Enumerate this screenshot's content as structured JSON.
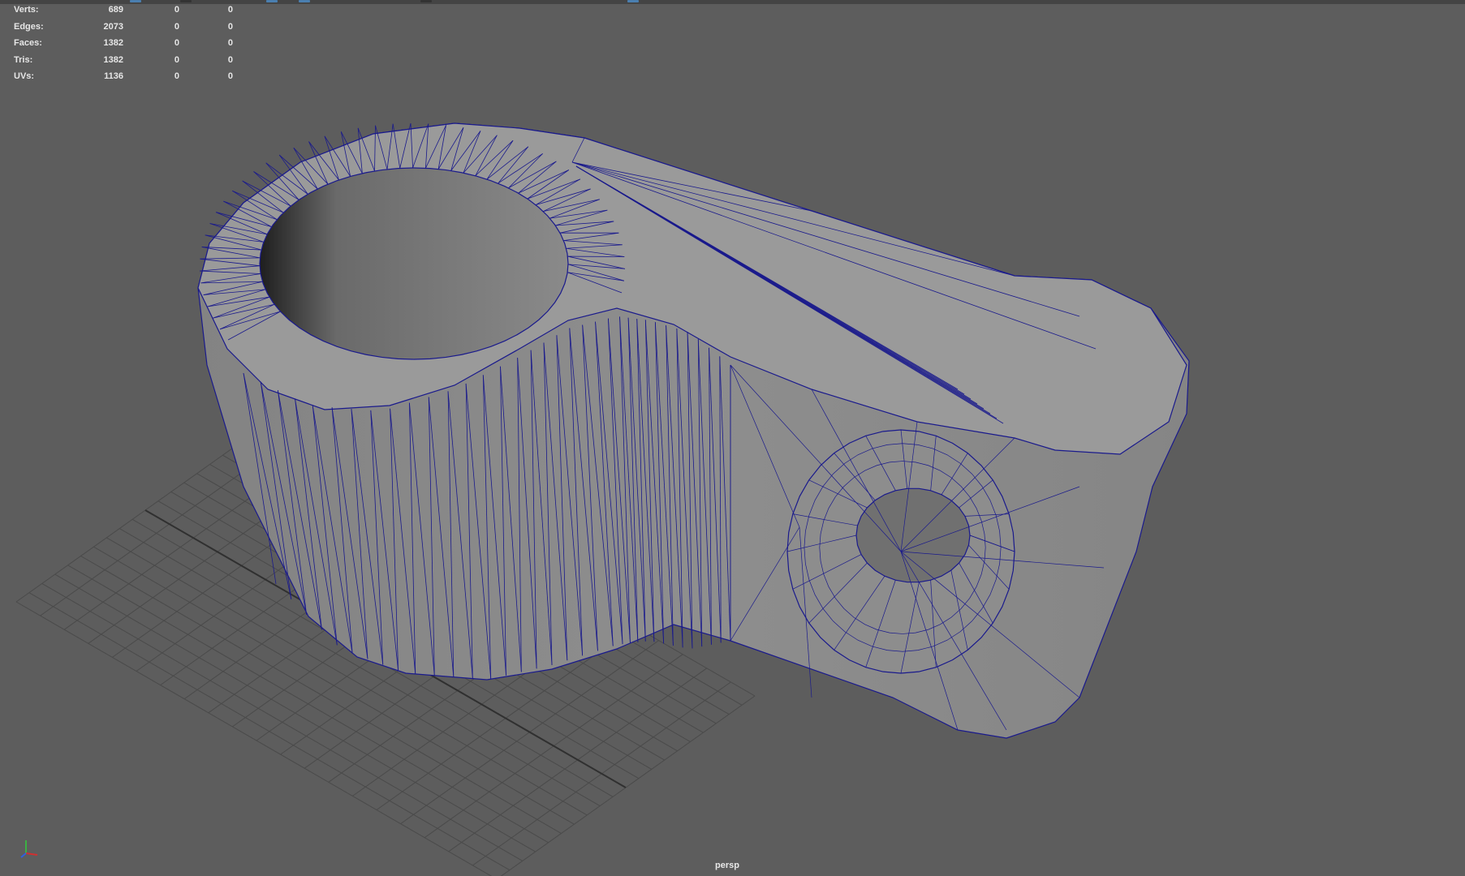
{
  "viewport": {
    "camera": "persp",
    "background_color": "#5d5d5d",
    "wireframe_color": "#1a1a8c",
    "mesh_color": "#8f8f8f"
  },
  "heads_up_display": {
    "rows": [
      {
        "label": "Verts:",
        "total": "689",
        "selected": "0",
        "selected_face": "0"
      },
      {
        "label": "Edges:",
        "total": "2073",
        "selected": "0",
        "selected_face": "0"
      },
      {
        "label": "Faces:",
        "total": "1382",
        "selected": "0",
        "selected_face": "0"
      },
      {
        "label": "Tris:",
        "total": "1382",
        "selected": "0",
        "selected_face": "0"
      },
      {
        "label": "UVs:",
        "total": "1136",
        "selected": "0",
        "selected_face": "0"
      }
    ]
  },
  "axis_gizmo": {
    "icon": "xyz-axis-icon"
  }
}
